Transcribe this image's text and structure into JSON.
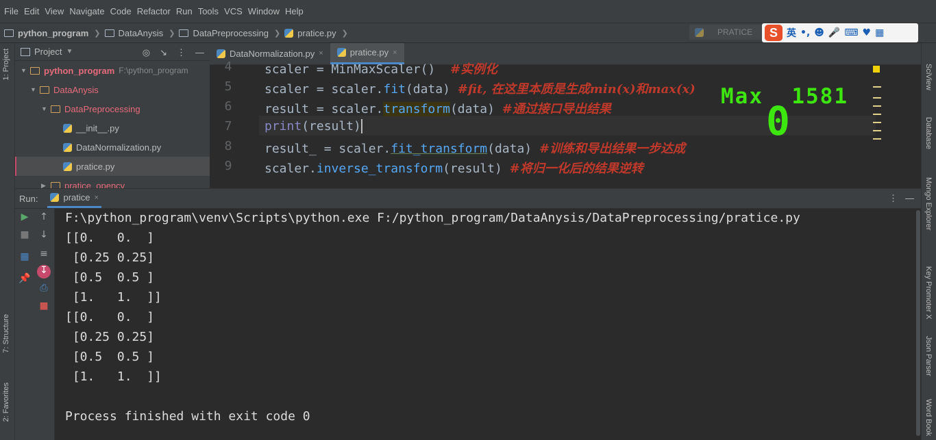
{
  "menu": [
    "File",
    "Edit",
    "View",
    "Navigate",
    "Code",
    "Refactor",
    "Run",
    "Tools",
    "VCS",
    "Window",
    "Help"
  ],
  "breadcrumbs": [
    "python_program",
    "DataAnysis",
    "DataPreprocessing",
    "pratice.py"
  ],
  "run_config": "PRATICE",
  "ime": {
    "logo": "S",
    "lang": "英"
  },
  "left_strip": {
    "project": "1: Project",
    "structure": "7: Structure",
    "favorites": "2: Favorites"
  },
  "right_strip": [
    "SciView",
    "Database",
    "Mongo Explorer",
    "Key Promoter X",
    "Json Parser",
    "Word Book"
  ],
  "project_panel": {
    "title": "Project",
    "rows": [
      {
        "label": "python_program",
        "extra": "F:\\python_program"
      },
      {
        "label": "DataAnysis"
      },
      {
        "label": "DataPreprocessing"
      },
      {
        "label": "__init__.py"
      },
      {
        "label": "DataNormalization.py"
      },
      {
        "label": "pratice.py"
      },
      {
        "label": "pratice_opencv"
      }
    ]
  },
  "editor": {
    "tabs": [
      {
        "label": "DataNormalization.py",
        "close": "×"
      },
      {
        "label": "pratice.py",
        "close": "×"
      }
    ],
    "line_numbers": [
      "4",
      "5",
      "6",
      "7",
      "8",
      "9"
    ],
    "lines": [
      {
        "code": "scaler = MinMaxScaler()",
        "comment": "#实例化"
      },
      {
        "a": "scaler = scaler.",
        "fn": "fit",
        "b": "(data) ",
        "comment": "#fit, 在这里本质是生成min(x)和max(x)"
      },
      {
        "a": "result = scaler.",
        "fn": "transform",
        "b": "(data) ",
        "comment": "#通过接口导出结果"
      },
      {
        "pf": "print",
        "b": "(result)"
      },
      {
        "a": "result_ = scaler.",
        "fn": "fit_transform",
        "b": "(data) ",
        "comment": "#训练和导出结果一步达成"
      },
      {
        "a": "scaler.",
        "fn": "inverse_transform",
        "b": "(result) ",
        "comment": "#将归一化后的结果逆转"
      }
    ]
  },
  "overlay": {
    "max_label": "Max",
    "max_value": "1581",
    "score": "0"
  },
  "run_panel": {
    "label": "Run:",
    "tab": "pratice",
    "close": "×"
  },
  "console": [
    "F:\\python_program\\venv\\Scripts\\python.exe F:/python_program/DataAnysis/DataPreprocessing/pratice.py",
    "[[0.   0.  ]",
    " [0.25 0.25]",
    " [0.5  0.5 ]",
    " [1.   1.  ]]",
    "[[0.   0.  ]",
    " [0.25 0.25]",
    " [0.5  0.5 ]",
    " [1.   1.  ]]",
    "",
    "Process finished with exit code 0"
  ]
}
